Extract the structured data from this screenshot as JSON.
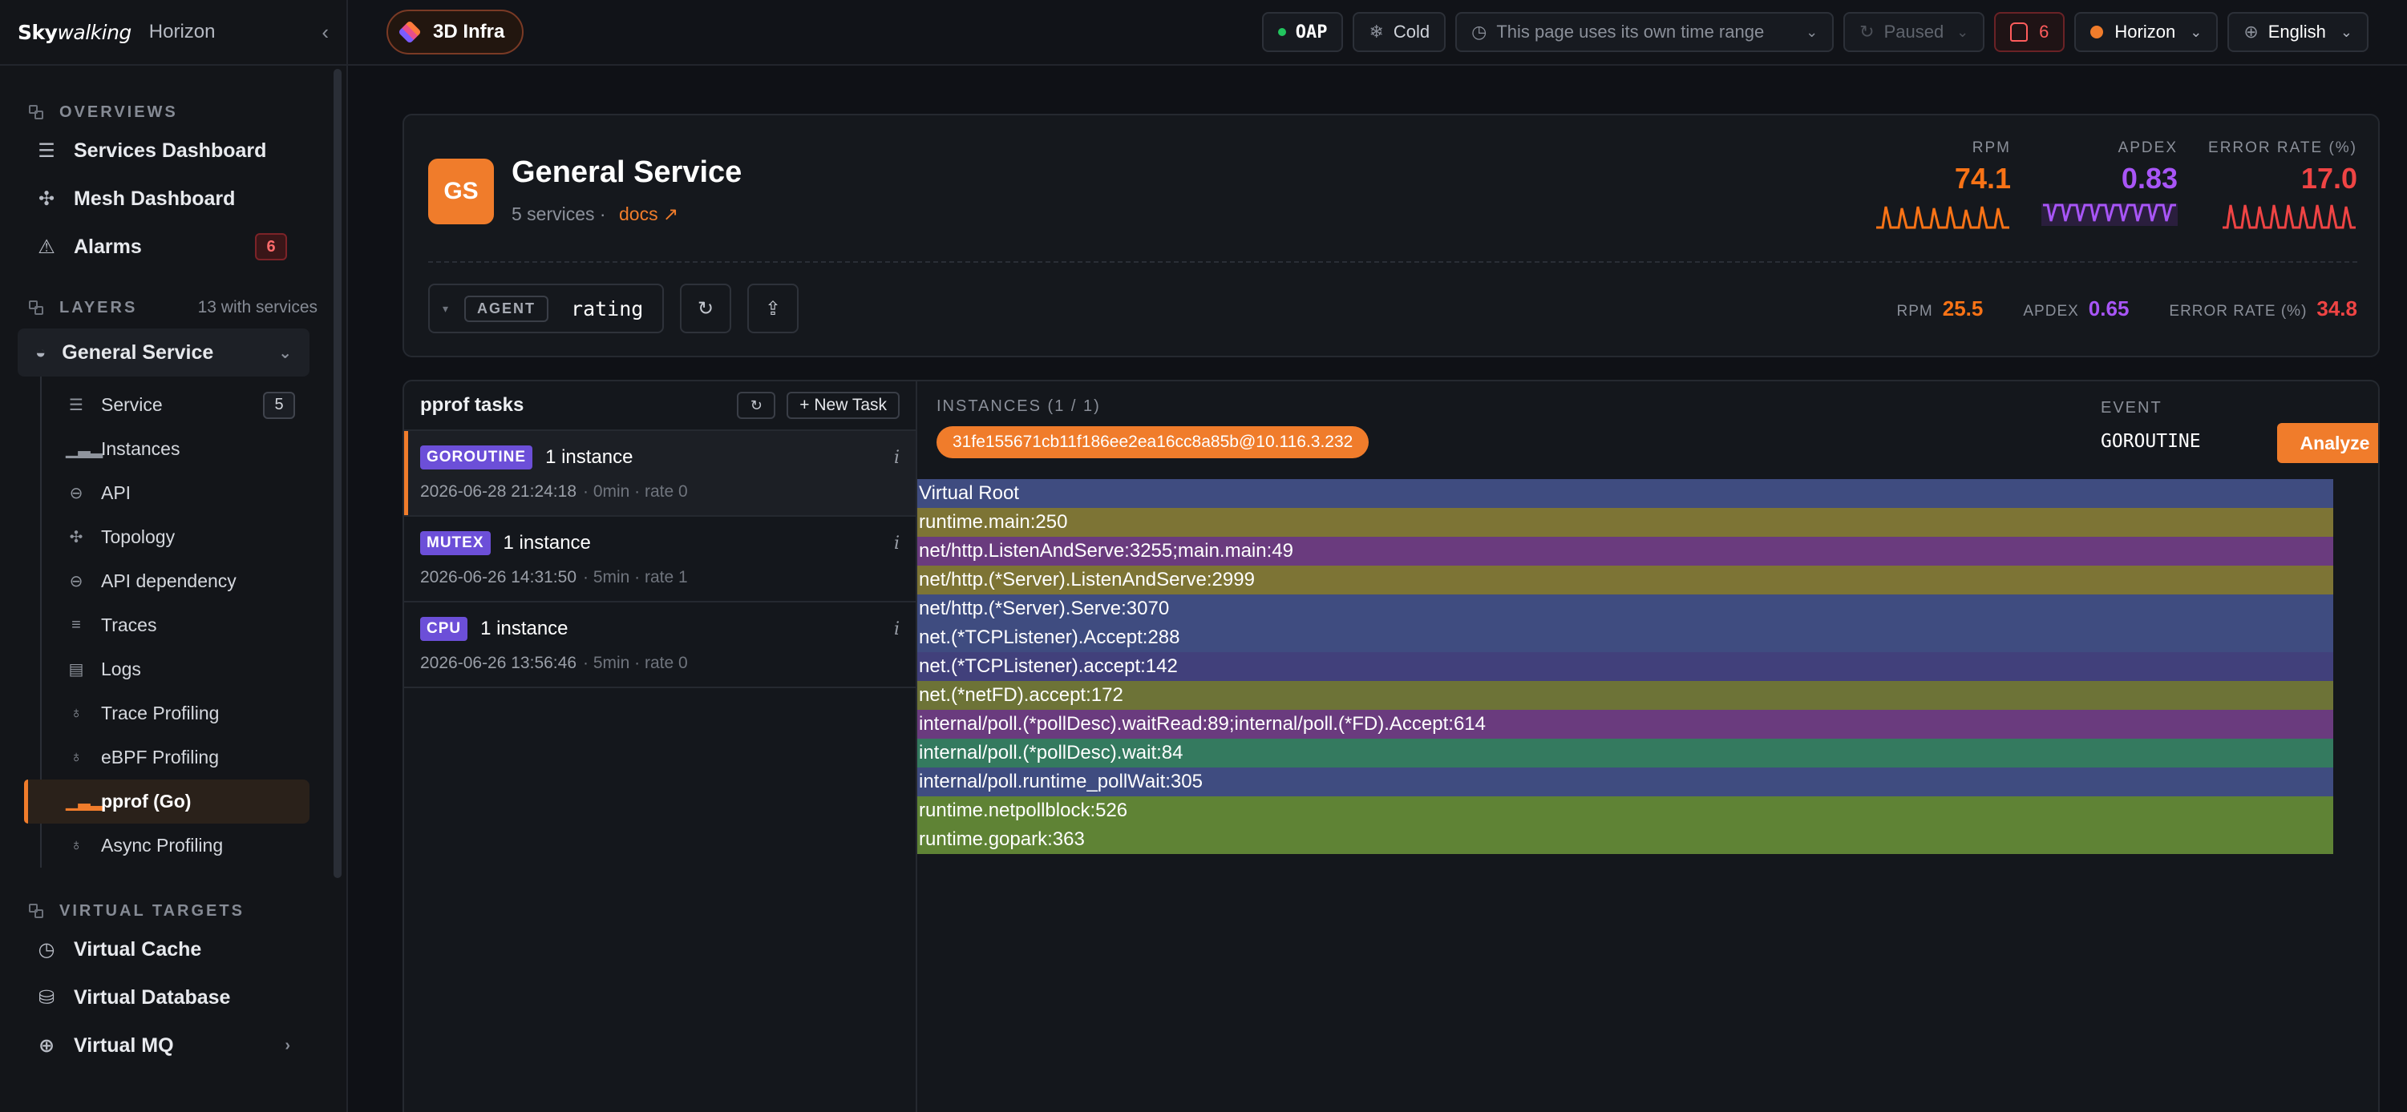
{
  "sidebar": {
    "logo_sky": "Sky",
    "logo_walking": "walking",
    "brand_name": "Horizon",
    "overviews_title": "OVERVIEWS",
    "overviews": [
      {
        "label": "Services Dashboard",
        "icon": "server-icon"
      },
      {
        "label": "Mesh Dashboard",
        "icon": "mesh-icon"
      },
      {
        "label": "Alarms",
        "icon": "alert-triangle-icon",
        "badge": "6"
      }
    ],
    "layers_title": "LAYERS",
    "layers_count": "13 with services",
    "active_group": "General Service",
    "sub_items": [
      {
        "label": "Service",
        "badge": "5"
      },
      {
        "label": "Instances"
      },
      {
        "label": "API"
      },
      {
        "label": "Topology"
      },
      {
        "label": "API dependency"
      },
      {
        "label": "Traces"
      },
      {
        "label": "Logs"
      },
      {
        "label": "Trace Profiling"
      },
      {
        "label": "eBPF Profiling"
      },
      {
        "label": "pprof (Go)"
      },
      {
        "label": "Async Profiling"
      }
    ],
    "virtual_title": "VIRTUAL TARGETS",
    "virtual": [
      {
        "label": "Virtual Cache"
      },
      {
        "label": "Virtual Database"
      },
      {
        "label": "Virtual MQ"
      }
    ]
  },
  "topbar": {
    "infra_label": "3D Infra",
    "oap_label": "OAP",
    "cold_label": "Cold",
    "time_label": "This page uses its own time range",
    "paused_label": "Paused",
    "alert_count": "6",
    "horizon_label": "Horizon",
    "language_label": "English"
  },
  "service": {
    "initials": "GS",
    "name": "General Service",
    "count_text": "5 services ·",
    "docs_label": "docs ↗",
    "metrics": [
      {
        "label": "RPM",
        "value": "74.1",
        "color": "#f97316"
      },
      {
        "label": "APDEX",
        "value": "0.83",
        "color": "#a855f7"
      },
      {
        "label": "ERROR RATE (%)",
        "value": "17.0",
        "color": "#ef4444"
      }
    ],
    "agent_tag": "AGENT",
    "agent_value": "rating",
    "sub_metrics": [
      {
        "label": "RPM",
        "value": "25.5",
        "color": "#f97316"
      },
      {
        "label": "APDEX",
        "value": "0.65",
        "color": "#a855f7"
      },
      {
        "label": "ERROR RATE (%)",
        "value": "34.8",
        "color": "#ef4444"
      }
    ]
  },
  "pprof": {
    "title": "pprof tasks",
    "new_task_label": "+ New Task",
    "tasks": [
      {
        "type": "GOROUTINE",
        "instances": "1 instance",
        "time": "2026-06-28 21:24:18",
        "meta": "· 0min · rate 0"
      },
      {
        "type": "MUTEX",
        "instances": "1 instance",
        "time": "2026-06-26 14:31:50",
        "meta": "· 5min · rate 1"
      },
      {
        "type": "CPU",
        "instances": "1 instance",
        "time": "2026-06-26 13:56:46",
        "meta": "· 5min · rate 0"
      }
    ],
    "instances_label": "INSTANCES (1 / 1)",
    "instance_id": "31fe155671cb11f186ee2ea16cc8a85b@10.116.3.232",
    "event_label": "EVENT",
    "event_value": "GOROUTINE",
    "analyze_label": "Analyze",
    "frames": [
      {
        "label": "Virtual Root",
        "color": "#3f4c80"
      },
      {
        "label": "runtime.main:250",
        "color": "#7d7435"
      },
      {
        "label": "net/http.ListenAndServe:3255;main.main:49",
        "color": "#6a3b7e"
      },
      {
        "label": "net/http.(*Server).ListenAndServe:2999",
        "color": "#7d7435"
      },
      {
        "label": "net/http.(*Server).Serve:3070",
        "color": "#3f4c80"
      },
      {
        "label": "net.(*TCPListener).Accept:288",
        "color": "#3f4c80"
      },
      {
        "label": "net.(*TCPListener).accept:142",
        "color": "#41407b"
      },
      {
        "label": "net.(*netFD).accept:172",
        "color": "#6d7337"
      },
      {
        "label": "internal/poll.(*pollDesc).waitRead:89;internal/poll.(*FD).Accept:614",
        "color": "#6a3b7e"
      },
      {
        "label": "internal/poll.(*pollDesc).wait:84",
        "color": "#347a5f"
      },
      {
        "label": "internal/poll.runtime_pollWait:305",
        "color": "#3f4c80"
      },
      {
        "label": "runtime.netpollblock:526",
        "color": "#5f8335"
      },
      {
        "label": "runtime.gopark:363",
        "color": "#5f8335"
      }
    ]
  }
}
